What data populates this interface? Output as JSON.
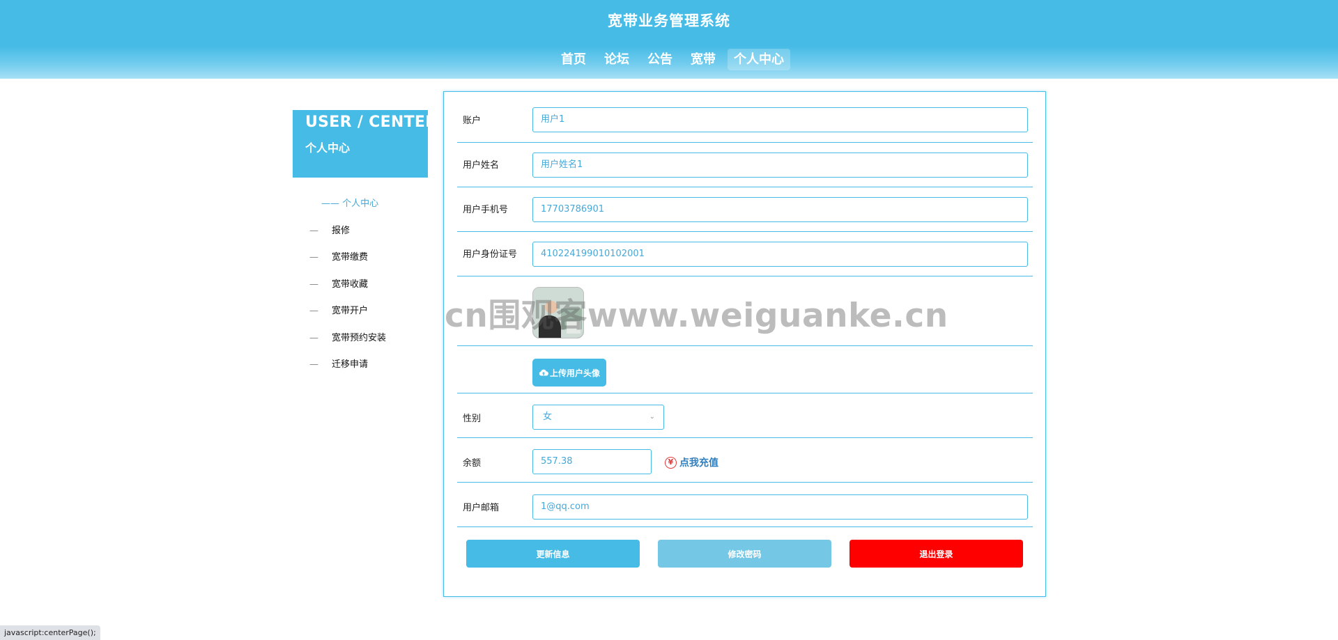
{
  "header": {
    "title": "宽带业务管理系统",
    "nav": [
      {
        "label": "首页"
      },
      {
        "label": "论坛"
      },
      {
        "label": "公告"
      },
      {
        "label": "宽带"
      },
      {
        "label": "个人中心",
        "active": true
      }
    ]
  },
  "sidebar": {
    "banner_en": "USER / CENTER",
    "banner_cn": "个人中心",
    "items": [
      {
        "label": "个人中心",
        "current": true,
        "dash": "——"
      },
      {
        "label": "报修",
        "dash": "—"
      },
      {
        "label": "宽带缴费",
        "dash": "—"
      },
      {
        "label": "宽带收藏",
        "dash": "—"
      },
      {
        "label": "宽带开户",
        "dash": "—"
      },
      {
        "label": "宽带预约安装",
        "dash": "—"
      },
      {
        "label": "迁移申请",
        "dash": "—"
      }
    ]
  },
  "form": {
    "account_label": "账户",
    "account_value": "用户1",
    "name_label": "用户姓名",
    "name_value": "用户姓名1",
    "phone_label": "用户手机号",
    "phone_value": "17703786901",
    "idcard_label": "用户身份证号",
    "idcard_value": "410224199010102001",
    "upload_label": "上传用户头像",
    "gender_label": "性别",
    "gender_value": "女",
    "balance_label": "余额",
    "balance_value": "557.38",
    "recharge_label": "点我充值",
    "email_label": "用户邮箱",
    "email_value": "1@qq.com"
  },
  "buttons": {
    "update": "更新信息",
    "change_password": "修改密码",
    "logout": "退出登录"
  },
  "colors": {
    "primary": "#45bbe6",
    "secondary": "#74c8e6",
    "danger": "#ff0000"
  },
  "watermark": "cn围观客www.weiguanke.cn",
  "status_bar": "javascript:centerPage();"
}
